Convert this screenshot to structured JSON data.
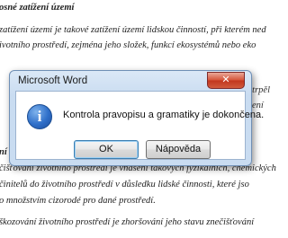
{
  "document": {
    "heading": "osné zatížení území",
    "line1": "zatížení území je takové zatížení území lidskou činností, při kterém ned",
    "line2": "ivotního prostředí, zejména jeho složek, funkcí ekosystémů nebo eko",
    "line3_right": "i, trpěl",
    "line4_right": "ení",
    "line6_bold": "ní",
    "line7": "čišťování životního prostředí je vnášení takových fyzikálních, chemických",
    "line8": "činitelů do životního prostředí v důsledku lidské činnosti, které jso",
    "line9": "o množstvím cizorodé pro dané prostředí.",
    "line10": "škozování životního prostředí je zhoršování jeho stavu znečišťování"
  },
  "dialog": {
    "title": "Microsoft Word",
    "close_glyph": "✕",
    "icon_glyph": "i",
    "message": "Kontrola pravopisu a gramatiky je dokončena.",
    "ok_label": "OK",
    "help_label": "Nápověda"
  }
}
